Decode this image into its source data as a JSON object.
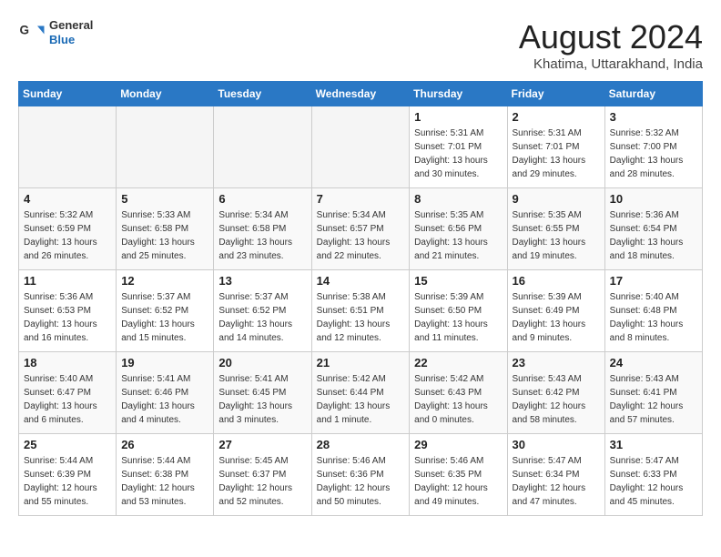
{
  "header": {
    "logo_general": "General",
    "logo_blue": "Blue",
    "month_title": "August 2024",
    "location": "Khatima, Uttarakhand, India"
  },
  "days_of_week": [
    "Sunday",
    "Monday",
    "Tuesday",
    "Wednesday",
    "Thursday",
    "Friday",
    "Saturday"
  ],
  "weeks": [
    [
      {
        "day": "",
        "info": ""
      },
      {
        "day": "",
        "info": ""
      },
      {
        "day": "",
        "info": ""
      },
      {
        "day": "",
        "info": ""
      },
      {
        "day": "1",
        "info": "Sunrise: 5:31 AM\nSunset: 7:01 PM\nDaylight: 13 hours\nand 30 minutes."
      },
      {
        "day": "2",
        "info": "Sunrise: 5:31 AM\nSunset: 7:01 PM\nDaylight: 13 hours\nand 29 minutes."
      },
      {
        "day": "3",
        "info": "Sunrise: 5:32 AM\nSunset: 7:00 PM\nDaylight: 13 hours\nand 28 minutes."
      }
    ],
    [
      {
        "day": "4",
        "info": "Sunrise: 5:32 AM\nSunset: 6:59 PM\nDaylight: 13 hours\nand 26 minutes."
      },
      {
        "day": "5",
        "info": "Sunrise: 5:33 AM\nSunset: 6:58 PM\nDaylight: 13 hours\nand 25 minutes."
      },
      {
        "day": "6",
        "info": "Sunrise: 5:34 AM\nSunset: 6:58 PM\nDaylight: 13 hours\nand 23 minutes."
      },
      {
        "day": "7",
        "info": "Sunrise: 5:34 AM\nSunset: 6:57 PM\nDaylight: 13 hours\nand 22 minutes."
      },
      {
        "day": "8",
        "info": "Sunrise: 5:35 AM\nSunset: 6:56 PM\nDaylight: 13 hours\nand 21 minutes."
      },
      {
        "day": "9",
        "info": "Sunrise: 5:35 AM\nSunset: 6:55 PM\nDaylight: 13 hours\nand 19 minutes."
      },
      {
        "day": "10",
        "info": "Sunrise: 5:36 AM\nSunset: 6:54 PM\nDaylight: 13 hours\nand 18 minutes."
      }
    ],
    [
      {
        "day": "11",
        "info": "Sunrise: 5:36 AM\nSunset: 6:53 PM\nDaylight: 13 hours\nand 16 minutes."
      },
      {
        "day": "12",
        "info": "Sunrise: 5:37 AM\nSunset: 6:52 PM\nDaylight: 13 hours\nand 15 minutes."
      },
      {
        "day": "13",
        "info": "Sunrise: 5:37 AM\nSunset: 6:52 PM\nDaylight: 13 hours\nand 14 minutes."
      },
      {
        "day": "14",
        "info": "Sunrise: 5:38 AM\nSunset: 6:51 PM\nDaylight: 13 hours\nand 12 minutes."
      },
      {
        "day": "15",
        "info": "Sunrise: 5:39 AM\nSunset: 6:50 PM\nDaylight: 13 hours\nand 11 minutes."
      },
      {
        "day": "16",
        "info": "Sunrise: 5:39 AM\nSunset: 6:49 PM\nDaylight: 13 hours\nand 9 minutes."
      },
      {
        "day": "17",
        "info": "Sunrise: 5:40 AM\nSunset: 6:48 PM\nDaylight: 13 hours\nand 8 minutes."
      }
    ],
    [
      {
        "day": "18",
        "info": "Sunrise: 5:40 AM\nSunset: 6:47 PM\nDaylight: 13 hours\nand 6 minutes."
      },
      {
        "day": "19",
        "info": "Sunrise: 5:41 AM\nSunset: 6:46 PM\nDaylight: 13 hours\nand 4 minutes."
      },
      {
        "day": "20",
        "info": "Sunrise: 5:41 AM\nSunset: 6:45 PM\nDaylight: 13 hours\nand 3 minutes."
      },
      {
        "day": "21",
        "info": "Sunrise: 5:42 AM\nSunset: 6:44 PM\nDaylight: 13 hours\nand 1 minute."
      },
      {
        "day": "22",
        "info": "Sunrise: 5:42 AM\nSunset: 6:43 PM\nDaylight: 13 hours\nand 0 minutes."
      },
      {
        "day": "23",
        "info": "Sunrise: 5:43 AM\nSunset: 6:42 PM\nDaylight: 12 hours\nand 58 minutes."
      },
      {
        "day": "24",
        "info": "Sunrise: 5:43 AM\nSunset: 6:41 PM\nDaylight: 12 hours\nand 57 minutes."
      }
    ],
    [
      {
        "day": "25",
        "info": "Sunrise: 5:44 AM\nSunset: 6:39 PM\nDaylight: 12 hours\nand 55 minutes."
      },
      {
        "day": "26",
        "info": "Sunrise: 5:44 AM\nSunset: 6:38 PM\nDaylight: 12 hours\nand 53 minutes."
      },
      {
        "day": "27",
        "info": "Sunrise: 5:45 AM\nSunset: 6:37 PM\nDaylight: 12 hours\nand 52 minutes."
      },
      {
        "day": "28",
        "info": "Sunrise: 5:46 AM\nSunset: 6:36 PM\nDaylight: 12 hours\nand 50 minutes."
      },
      {
        "day": "29",
        "info": "Sunrise: 5:46 AM\nSunset: 6:35 PM\nDaylight: 12 hours\nand 49 minutes."
      },
      {
        "day": "30",
        "info": "Sunrise: 5:47 AM\nSunset: 6:34 PM\nDaylight: 12 hours\nand 47 minutes."
      },
      {
        "day": "31",
        "info": "Sunrise: 5:47 AM\nSunset: 6:33 PM\nDaylight: 12 hours\nand 45 minutes."
      }
    ]
  ]
}
